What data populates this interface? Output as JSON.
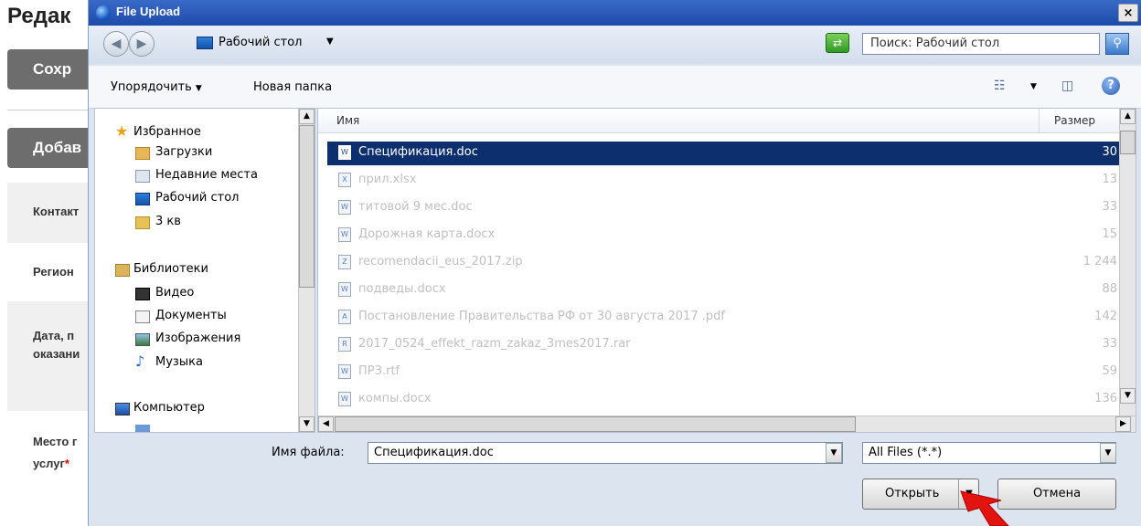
{
  "background_page": {
    "title": "Редак",
    "save_button": "Сохр",
    "add_button": "Добав",
    "rows": [
      "Контакт",
      "Регион",
      "Дата, п",
      "оказани",
      "Место г",
      "услуг"
    ],
    "required_mark": "*"
  },
  "dialog": {
    "title": "File Upload",
    "close_label": "×",
    "address": "Рабочий стол",
    "search_placeholder": "Поиск: Рабочий стол",
    "toolbar": {
      "organize": "Упорядочить",
      "new_folder": "Новая папка"
    },
    "nav_pane": {
      "favorites": "Избранное",
      "downloads": "Загрузки",
      "recent": "Недавние места",
      "desktop": "Рабочий стол",
      "folder_3kv": "3 кв",
      "libraries": "Библиотеки",
      "video": "Видео",
      "documents": "Документы",
      "images": "Изображения",
      "music": "Музыка",
      "computer": "Компьютер"
    },
    "columns": {
      "name": "Имя",
      "size": "Размер"
    },
    "files": [
      {
        "name": "Спецификация.doc",
        "size": "30",
        "icon": "word-doc-icon",
        "selected": true
      },
      {
        "name": "прил.xlsx",
        "size": "13",
        "icon": "excel-icon",
        "selected": false
      },
      {
        "name": "титовой 9 мес.doc",
        "size": "33",
        "icon": "word-doc-icon",
        "selected": false
      },
      {
        "name": "Дорожная карта.docx",
        "size": "15",
        "icon": "word-doc-icon",
        "selected": false
      },
      {
        "name": "recomendacii_eus_2017.zip",
        "size": "1 244",
        "icon": "zip-icon",
        "selected": false
      },
      {
        "name": "подведы.docx",
        "size": "88",
        "icon": "word-doc-icon",
        "selected": false
      },
      {
        "name": "Постановление Правительства РФ от 30 августа 2017 .pdf",
        "size": "142",
        "icon": "pdf-icon",
        "selected": false
      },
      {
        "name": "2017_0524_effekt_razm_zakaz_3mes2017.rar",
        "size": "33",
        "icon": "rar-icon",
        "selected": false
      },
      {
        "name": "ПРЗ.rtf",
        "size": "59",
        "icon": "word-doc-icon",
        "selected": false
      },
      {
        "name": "компы.docx",
        "size": "136",
        "icon": "word-doc-icon",
        "selected": false
      }
    ],
    "filename_label": "Имя файла:",
    "filename_value": "Спецификация.doc",
    "filter_value": "All Files (*.*)",
    "open_button": "Открыть",
    "cancel_button": "Отмена"
  }
}
